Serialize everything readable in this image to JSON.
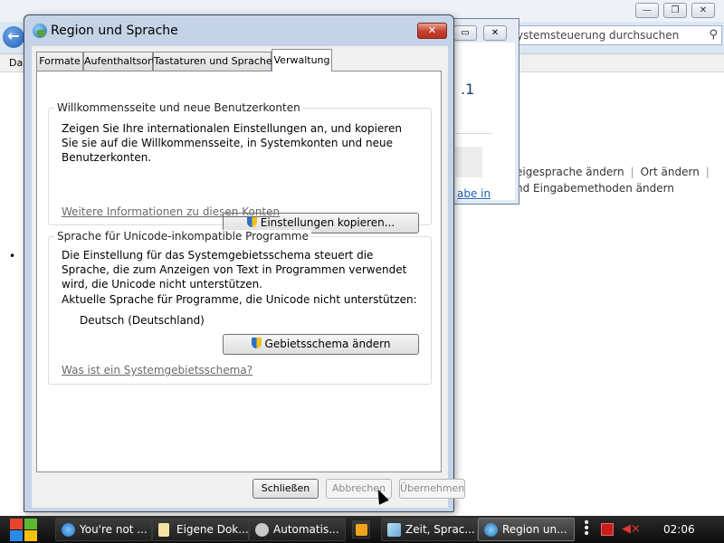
{
  "background": {
    "search_placeholder": "ystemsteuerung durchsuchen",
    "menu_partial": "Da",
    "link_row1": [
      "eigesprache ändern",
      "Ort ändern"
    ],
    "link_row2": "nd Eingabemethoden ändern",
    "mid_window_text": ".1",
    "mid_window_link": "abe in"
  },
  "dialog": {
    "title": "Region und Sprache",
    "tabs": [
      "Formate",
      "Aufenthaltsort",
      "Tastaturen und Sprachen",
      "Verwaltung"
    ],
    "active_tab": "Verwaltung",
    "welcome": {
      "legend": "Willkommensseite und neue Benutzerkonten",
      "description": "Zeigen Sie Ihre internationalen Einstellungen an, und kopieren Sie sie auf die Willkommensseite, in Systemkonten und neue Benutzerkonten.",
      "copy_button": "Einstellungen kopieren...",
      "info_link": "Weitere Informationen zu diesen Konten"
    },
    "unicode": {
      "legend": "Sprache für Unicode-inkompatible Programme",
      "description": "Die Einstellung für das Systemgebietsschema steuert die Sprache, die zum Anzeigen von Text in Programmen verwendet wird, die Unicode nicht unterstützen.",
      "current_label": "Aktuelle Sprache für Programme, die Unicode nicht unterstützen:",
      "current_value": "Deutsch (Deutschland)",
      "locale_button": "Gebietsschema ändern",
      "info_link": "Was ist ein Systemgebietsschema?"
    },
    "footer": {
      "close": "Schließen",
      "cancel": "Abbrechen",
      "apply": "Übernehmen"
    }
  },
  "taskbar": {
    "items": [
      {
        "label": "You're not ...",
        "icon": "ie-icon"
      },
      {
        "label": "Eigene Dok...",
        "icon": "document-icon"
      },
      {
        "label": "Automatis...",
        "icon": "automation-icon"
      },
      {
        "label": "Zeit, Sprac...",
        "icon": "control-panel-icon"
      },
      {
        "label": "Region un...",
        "icon": "globe-icon"
      }
    ],
    "clock": "02:06"
  }
}
